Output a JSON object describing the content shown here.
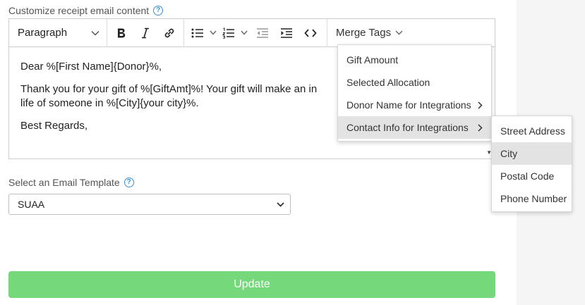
{
  "receipt": {
    "label": "Customize receipt email content",
    "help_icon": "?"
  },
  "toolbar": {
    "paragraph": "Paragraph",
    "merge_tags": "Merge Tags"
  },
  "content": {
    "line1": "Dear %[First Name]{Donor}%,",
    "line2a": "Thank you for your gift of %[GiftAmt]%! Your gift will make an in",
    "line2b": "life of someone in %[City]{your city}%.",
    "line3": "Best Regards,"
  },
  "merge_menu": {
    "items": [
      {
        "label": "Gift Amount"
      },
      {
        "label": "Selected Allocation"
      },
      {
        "label": "Donor Name for Integrations"
      },
      {
        "label": "Contact Info for Integrations"
      }
    ]
  },
  "contact_submenu": {
    "items": [
      {
        "label": "Street Address"
      },
      {
        "label": "City"
      },
      {
        "label": "Postal Code"
      },
      {
        "label": "Phone Number"
      }
    ]
  },
  "template": {
    "label": "Select an Email Template",
    "help_icon": "?",
    "value": "SUAA"
  },
  "update_button": "Update",
  "colors": {
    "update": "#75d97b",
    "help": "#3b8fd6"
  }
}
